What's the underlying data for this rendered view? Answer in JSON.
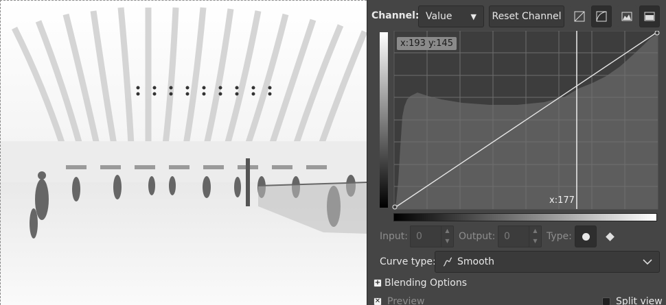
{
  "canvas": {
    "description_icon": "photo-canvas"
  },
  "curves": {
    "channel_label": "Channel:",
    "channel_value": "Value",
    "reset_label": "Reset Channel",
    "coord_badge": "x:193 y:145",
    "x_readout": "x:177",
    "input_label": "Input:",
    "input_value": "0",
    "output_label": "Output:",
    "output_value": "0",
    "type_label": "Type:",
    "curve_type_label": "Curve type:",
    "curve_type_value": "Smooth",
    "blending_label": "Blending Options",
    "preview_label": "Preview",
    "split_view_label": "Split view"
  },
  "icons": {
    "linear": "linear-histogram-icon",
    "log": "log-histogram-icon",
    "natural": "natural-view-icon",
    "logarithmic": "logarithmic-view-icon"
  }
}
